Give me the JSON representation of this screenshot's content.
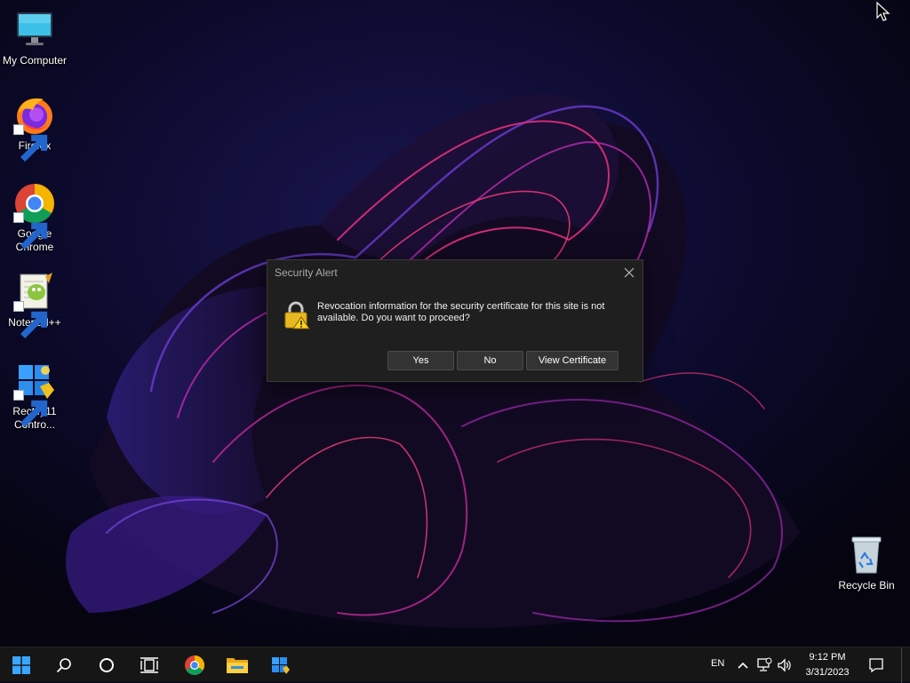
{
  "desktop": {
    "icons": [
      {
        "label": "My Computer",
        "icon": "monitor-icon"
      },
      {
        "label": "Firefox",
        "icon": "firefox-icon"
      },
      {
        "label": "Google\nChrome",
        "icon": "chrome-icon"
      },
      {
        "label": "Notepad++",
        "icon": "notepadpp-icon"
      },
      {
        "label": "Rectify11\nContro...",
        "icon": "control-panel-icon"
      },
      {
        "label": "Recycle Bin",
        "icon": "recycle-bin-icon"
      }
    ]
  },
  "dialog": {
    "title": "Security Alert",
    "message": "Revocation information for the security certificate for this site is not available. Do you want to proceed?",
    "buttons": {
      "yes": "Yes",
      "no": "No",
      "view_certificate": "View Certificate"
    },
    "icon": "lock-warning-icon"
  },
  "taskbar": {
    "items": [
      "start-icon",
      "search-icon",
      "cortana-icon",
      "task-view-icon",
      "chrome-icon",
      "file-explorer-icon",
      "control-panel-icon"
    ],
    "tray": {
      "language": "EN",
      "time": "9:12 PM",
      "date": "3/31/2023"
    }
  },
  "colors": {
    "dialog_bg": "#1f1f1f",
    "taskbar_bg": "#161616",
    "wallpaper_base": "#07061a",
    "wallpaper_accent": "#d02a8a"
  }
}
